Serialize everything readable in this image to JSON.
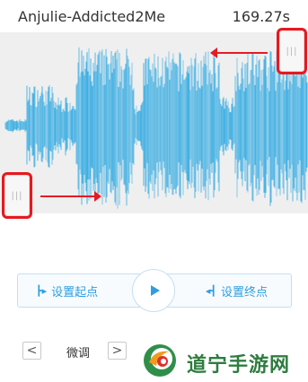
{
  "header": {
    "title": "Anjulie-Addicted2Me",
    "duration": "169.27s"
  },
  "waveform": {
    "color": "#3baee3",
    "background": "#efefef"
  },
  "handles": {
    "grip": "|||"
  },
  "controls": {
    "set_start_label": "设置起点",
    "set_end_label": "设置终点",
    "play_icon": "play-icon",
    "accent": "#2e9ee0"
  },
  "fine_tune": {
    "label": "微调",
    "prev_glyph": "<",
    "next_glyph": ">"
  },
  "watermark": {
    "text": "道宁手游网"
  },
  "annotation_color": "#e51b23"
}
